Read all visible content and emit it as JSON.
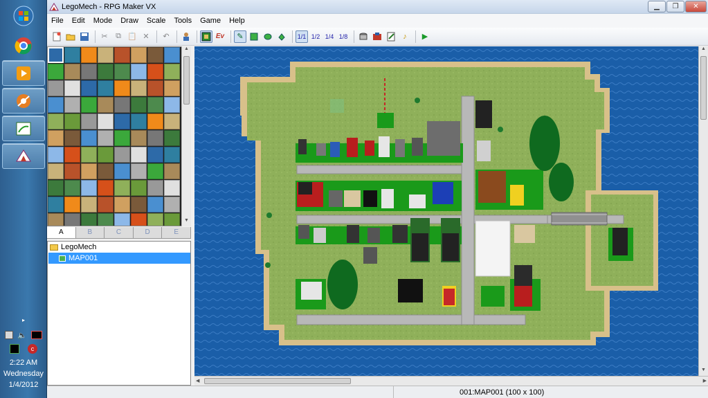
{
  "window": {
    "title": "LegoMech - RPG Maker VX",
    "controls": [
      "minimize",
      "restore",
      "close"
    ]
  },
  "menu": [
    "File",
    "Edit",
    "Mode",
    "Draw",
    "Scale",
    "Tools",
    "Game",
    "Help"
  ],
  "toolbar": {
    "group1": [
      "new-project-icon",
      "open-project-icon",
      "save-project-icon"
    ],
    "group2": [
      "cut-icon",
      "copy-icon",
      "paste-icon",
      "delete-icon"
    ],
    "group3": [
      "undo-icon"
    ],
    "group4": [
      "map-mode-icon",
      "event-mode-icon"
    ],
    "ev_label": "Ev",
    "group5": [
      "pencil-icon",
      "rectangle-icon",
      "ellipse-icon",
      "fill-icon"
    ],
    "scales": [
      "1/1",
      "1/2",
      "1/4",
      "1/8"
    ],
    "group7": [
      "database-icon",
      "resource-manager-icon",
      "script-editor-icon",
      "sound-test-icon"
    ],
    "playtest": "playtest-icon"
  },
  "tileset": {
    "tabs": [
      "A",
      "B",
      "C",
      "D",
      "E"
    ],
    "active_tab": "A"
  },
  "tree": {
    "root": "LegoMech",
    "maps": [
      "MAP001"
    ],
    "selected": "MAP001"
  },
  "status": {
    "map_info": "001:MAP001 (100 x 100)"
  },
  "taskbar": {
    "time": "2:22 AM",
    "day": "Wednesday",
    "date": "1/4/2012"
  },
  "colors": {
    "water": "#1a5ea8",
    "grass": "#8fb05a",
    "sand": "#d8c08a",
    "road": "#b8b8b8",
    "accent": "#3399ff"
  }
}
